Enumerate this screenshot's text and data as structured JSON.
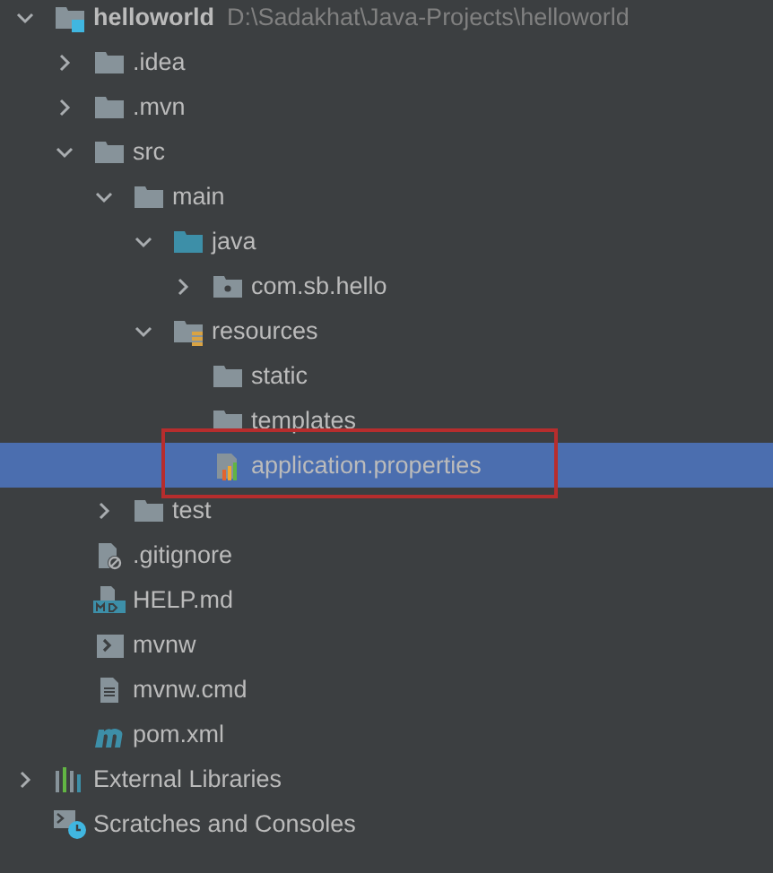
{
  "tree": [
    {
      "label": "helloworld",
      "path": "D:\\Sadakhat\\Java-Projects\\helloworld",
      "kind": "project",
      "expanded": true,
      "selected": false,
      "children": [
        {
          "label": ".idea",
          "kind": "folder",
          "expanded": false,
          "selected": false
        },
        {
          "label": ".mvn",
          "kind": "folder",
          "expanded": false,
          "selected": false
        },
        {
          "label": "src",
          "kind": "folder",
          "expanded": true,
          "selected": false,
          "children": [
            {
              "label": "main",
              "kind": "folder",
              "expanded": true,
              "selected": false,
              "children": [
                {
                  "label": "java",
                  "kind": "source",
                  "expanded": true,
                  "selected": false,
                  "children": [
                    {
                      "label": "com.sb.hello",
                      "kind": "package",
                      "expanded": false,
                      "selected": false
                    }
                  ]
                },
                {
                  "label": "resources",
                  "kind": "resources",
                  "expanded": true,
                  "selected": false,
                  "children": [
                    {
                      "label": "static",
                      "kind": "folder",
                      "selected": false
                    },
                    {
                      "label": "templates",
                      "kind": "folder",
                      "selected": false
                    },
                    {
                      "label": "application.properties",
                      "kind": "properties",
                      "selected": true,
                      "annotated": true
                    }
                  ]
                }
              ]
            },
            {
              "label": "test",
              "kind": "folder",
              "expanded": false,
              "selected": false
            }
          ]
        },
        {
          "label": ".gitignore",
          "kind": "ignore",
          "selected": false
        },
        {
          "label": "HELP.md",
          "kind": "markdown",
          "selected": false
        },
        {
          "label": "mvnw",
          "kind": "shell",
          "selected": false
        },
        {
          "label": "mvnw.cmd",
          "kind": "text",
          "selected": false
        },
        {
          "label": "pom.xml",
          "kind": "maven",
          "selected": false
        }
      ]
    },
    {
      "label": "External Libraries",
      "kind": "libraries",
      "expanded": false,
      "selected": false
    },
    {
      "label": "Scratches and Consoles",
      "kind": "scratches",
      "selected": false
    }
  ]
}
